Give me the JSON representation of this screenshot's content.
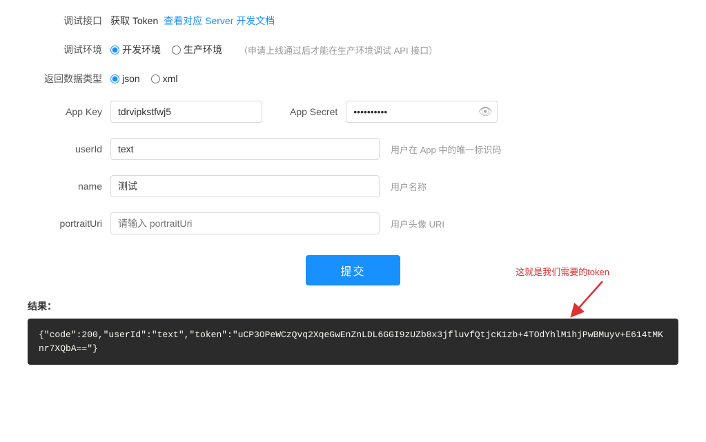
{
  "header": {
    "debug_interface_label": "调试接口",
    "get_token_label": "获取 Token",
    "server_doc_link": "查看对应 Server 开发文档"
  },
  "env": {
    "label": "调试环境",
    "dev_label": "开发环境",
    "prod_label": "生产环境",
    "prod_hint": "（申请上线通过后才能在生产环境调试 API 接口）"
  },
  "return_type": {
    "label": "返回数据类型",
    "json_label": "json",
    "xml_label": "xml"
  },
  "app_key": {
    "label": "App Key",
    "value": "tdrvipkstfwj5"
  },
  "app_secret": {
    "label": "App Secret",
    "value": "**********"
  },
  "fields": [
    {
      "label": "userId",
      "value": "text",
      "placeholder": "",
      "hint": "用户在 App 中的唯一标识码"
    },
    {
      "label": "name",
      "value": "测试",
      "placeholder": "",
      "hint": "用户名称"
    },
    {
      "label": "portraitUri",
      "value": "",
      "placeholder": "请输入 portraitUri",
      "hint": "用户头像 URI"
    }
  ],
  "submit_button": "提交",
  "result_label": "结果：",
  "result_value": "{\"code\":200,\"userId\":\"text\",\"token\":\"uCP3OPeWCzQvq2XqeGwEnZnLDL6GGI9zUZb8x3jfluvfQtjcK1zb+4TOdYhlM1hjPwBMuyv+E614tMKnr7XQbA==\"}",
  "annotation": "这就是我们需要的token"
}
